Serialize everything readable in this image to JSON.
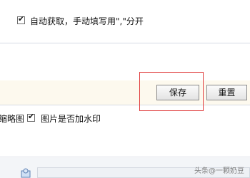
{
  "options": {
    "auto_fetch_label": "自动获取，手动填写用\",\"分开",
    "auto_fetch_checked": true,
    "thumbnail_label_partial": "缩略图",
    "watermark_label": "图片是否加水印",
    "watermark_checked": true
  },
  "actions": {
    "save_label": "保存",
    "reset_label": "重置"
  },
  "footer": {
    "watermark_text": "头条@一颗奶豆"
  },
  "colors": {
    "highlight_border": "#e03b3b",
    "action_bar_bg": "#fdf9ee"
  }
}
